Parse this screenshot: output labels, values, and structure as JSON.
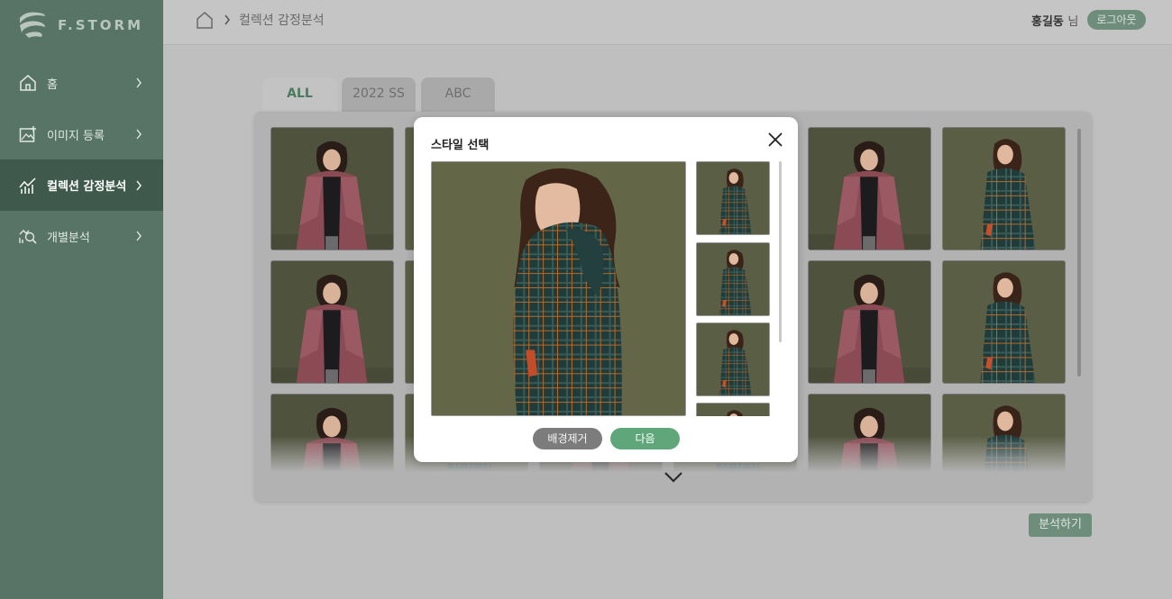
{
  "app": {
    "logo_text": "F.STORM"
  },
  "sidebar": {
    "items": [
      {
        "label": "홈",
        "icon": "home-icon",
        "active": false
      },
      {
        "label": "이미지 등록",
        "icon": "image-add-icon",
        "active": false
      },
      {
        "label": "컬렉션 감정분석",
        "icon": "trend-chart-icon",
        "active": true
      },
      {
        "label": "개별분석",
        "icon": "analysis-search-icon",
        "active": false
      }
    ]
  },
  "header": {
    "breadcrumb": "컬렉션 감정분석",
    "user_name": "홍길동",
    "user_suffix": "님",
    "logout_label": "로그아웃"
  },
  "tabs": [
    {
      "label": "ALL",
      "active": true
    },
    {
      "label": "2022 SS",
      "active": false
    },
    {
      "label": "ABC",
      "active": false
    }
  ],
  "gallery": {
    "columns": 6,
    "rows_visible": 3,
    "image_types": [
      "red-coat",
      "plaid-coat"
    ]
  },
  "analyze_button": "분석하기",
  "modal": {
    "title": "스타일 선택",
    "remove_bg_label": "배경제거",
    "next_label": "다음"
  },
  "colors": {
    "brand_green": "#577466",
    "sidebar_active": "#3f5a4d",
    "accent_green": "#5fa77a",
    "overlay_gray": "#bfbfbf"
  }
}
